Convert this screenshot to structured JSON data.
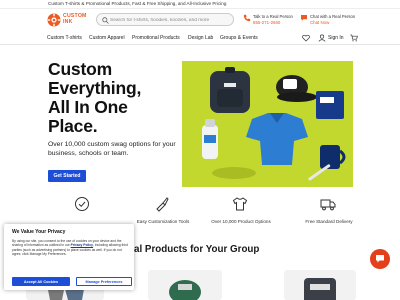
{
  "topbar": {
    "text": "Custom T-shirts & Promotional Products, Fast & Free Shipping, and All-Inclusive Pricing"
  },
  "header": {
    "logo_text_line1": "CUSTOM",
    "logo_text_line2": "INK",
    "search_placeholder": "Search for t-shirts, hoodies, koozies, and more",
    "phone_label": "Talk to a Real Person",
    "phone_number": "855-271-2660",
    "chat_label": "Chat with a Real Person",
    "chat_link": "Chat Now"
  },
  "nav": {
    "items": [
      "Custom T-shirts",
      "Custom Apparel",
      "Promotional Products",
      "Design Lab",
      "Groups & Events"
    ],
    "signin": "Sign In"
  },
  "hero": {
    "title_line1": "Custom",
    "title_line2": "Everything,",
    "title_line3": "All In One",
    "title_line4": "Place.",
    "subtitle": "Over 10,000 custom swag options for your business, schools or team.",
    "cta": "Get Started"
  },
  "features": [
    {
      "label": "",
      "icon": "check-badge-icon"
    },
    {
      "label": "Easy Customization Tools",
      "icon": "brush-icon"
    },
    {
      "label": "Over 10,000 Product Options",
      "icon": "shirt-icon"
    },
    {
      "label": "Free Standard Delivery",
      "icon": "truck-icon"
    }
  ],
  "section": {
    "title": "rts & Promotional Products for Your Group"
  },
  "cookie": {
    "title": "We Value Your Privacy",
    "body_start": "By using our site, you consent to the use of cookies on your device and the sharing of information as outlined in our ",
    "body_link": "Privacy Policy",
    "body_end": ", including allowing third parties (such as advertising partners) to place cookies as well. If you do not agree, click Manage My Preferences.",
    "accept": "Accept All Cookies",
    "manage": "Manage Preferences"
  },
  "colors": {
    "brand_orange": "#ee5a24",
    "cta_blue": "#1d4ed8",
    "hero_bg": "#c3d82f",
    "chat_fab": "#e53e1a"
  }
}
